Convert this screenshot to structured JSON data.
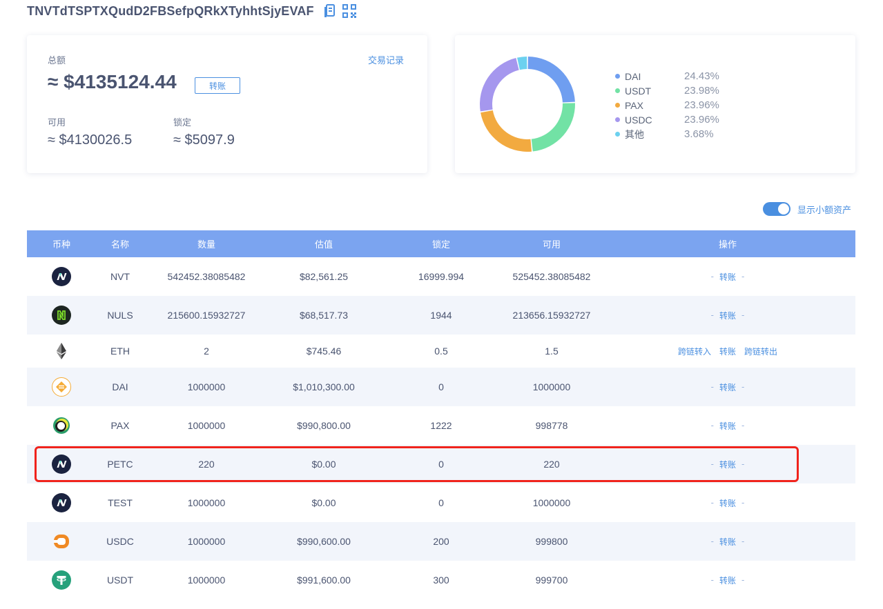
{
  "header": {
    "address": "TNVTdTSPTXQudD2FBSefpQRkXTyhhtSjyEVAF",
    "copy_icon": "copy-icon",
    "qr_icon": "qr-code-icon"
  },
  "summary": {
    "total_label": "总额",
    "total_value": "≈ $4135124.44",
    "transfer_label": "转账",
    "history_link": "交易记录",
    "available_label": "可用",
    "available_value": "≈ $4130026.5",
    "locked_label": "锁定",
    "locked_value": "≈ $5097.9"
  },
  "chart_data": {
    "type": "pie",
    "categories": [
      "DAI",
      "USDT",
      "PAX",
      "USDC",
      "其他"
    ],
    "values": [
      24.43,
      23.98,
      23.96,
      23.96,
      3.68
    ],
    "labels": [
      "24.43%",
      "23.98%",
      "23.96%",
      "23.96%",
      "3.68%"
    ],
    "colors": [
      "#6f9ef0",
      "#72e2a5",
      "#f2aa40",
      "#a597ee",
      "#6cd1ef"
    ],
    "legend": "right"
  },
  "toggle": {
    "label": "显示小额资产",
    "on": true,
    "color": "#4a8fe0"
  },
  "table": {
    "columns": [
      "币种",
      "名称",
      "数量",
      "估值",
      "锁定",
      "可用",
      "操作"
    ],
    "rows": [
      {
        "icon": "nerve-logo-icon",
        "name": "NVT",
        "amount": "542452.38085482",
        "value": "$82,561.25",
        "locked": "16999.994",
        "available": "525452.38085482",
        "ops": [
          "-",
          "转账",
          "-"
        ]
      },
      {
        "icon": "nuls-logo-icon",
        "name": "NULS",
        "amount": "215600.15932727",
        "value": "$68,517.73",
        "locked": "1944",
        "available": "213656.15932727",
        "ops": [
          "-",
          "转账",
          "-"
        ]
      },
      {
        "icon": "eth-logo-icon",
        "name": "ETH",
        "amount": "2",
        "value": "$745.46",
        "locked": "0.5",
        "available": "1.5",
        "ops": [
          "跨链转入",
          "转账",
          "跨链转出"
        ]
      },
      {
        "icon": "dai-logo-icon",
        "name": "DAI",
        "amount": "1000000",
        "value": "$1,010,300.00",
        "locked": "0",
        "available": "1000000",
        "ops": [
          "-",
          "转账",
          "-"
        ]
      },
      {
        "icon": "pax-logo-icon",
        "name": "PAX",
        "amount": "1000000",
        "value": "$990,800.00",
        "locked": "1222",
        "available": "998778",
        "ops": [
          "-",
          "转账",
          "-"
        ]
      },
      {
        "icon": "nerve-logo-icon",
        "name": "PETC",
        "amount": "220",
        "value": "$0.00",
        "locked": "0",
        "available": "220",
        "ops": [
          "-",
          "转账",
          "-"
        ]
      },
      {
        "icon": "nerve-logo-icon",
        "name": "TEST",
        "amount": "1000000",
        "value": "$0.00",
        "locked": "0",
        "available": "1000000",
        "ops": [
          "-",
          "转账",
          "-"
        ]
      },
      {
        "icon": "usdc-logo-icon",
        "name": "USDC",
        "amount": "1000000",
        "value": "$990,600.00",
        "locked": "200",
        "available": "999800",
        "ops": [
          "-",
          "转账",
          "-"
        ]
      },
      {
        "icon": "usdt-logo-icon",
        "name": "USDT",
        "amount": "1000000",
        "value": "$991,600.00",
        "locked": "300",
        "available": "999700",
        "ops": [
          "-",
          "转账",
          "-"
        ]
      }
    ]
  },
  "highlight": {
    "row": "PETC",
    "color": "#f0231c"
  }
}
